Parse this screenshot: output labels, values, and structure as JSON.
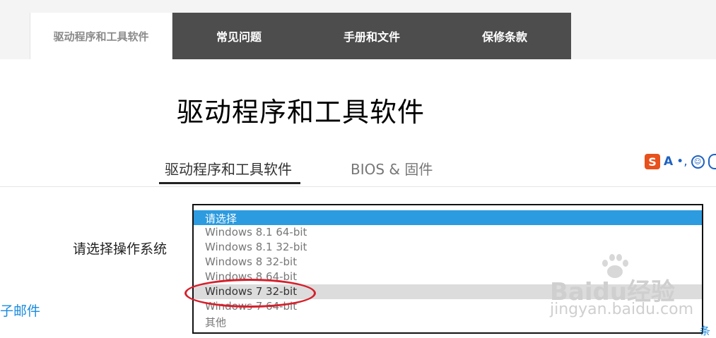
{
  "nav": {
    "tabs": [
      {
        "label": "驱动程序和工具软件",
        "active": true
      },
      {
        "label": "常见问题"
      },
      {
        "label": "手册和文件"
      },
      {
        "label": "保修条款"
      }
    ]
  },
  "main": {
    "title": "驱动程序和工具软件",
    "subtabs": [
      {
        "label": "驱动程序和工具软件",
        "active": true
      },
      {
        "label": "BIOS & 固件"
      }
    ],
    "os_label": "请选择操作系统",
    "email_link": "子邮件"
  },
  "os_select": {
    "options": [
      {
        "label": "请选择",
        "selected": true
      },
      {
        "label": "Windows 8.1 64-bit"
      },
      {
        "label": "Windows 8.1 32-bit"
      },
      {
        "label": "Windows 8 32-bit"
      },
      {
        "label": "Windows 8 64-bit"
      },
      {
        "label": "Windows 7 32-bit",
        "highlighted": true
      },
      {
        "label": "Windows 7 64-bit"
      },
      {
        "label": "其他"
      }
    ]
  },
  "ime_toolbar": {
    "logo_letter": "S",
    "mode_letter": "A",
    "punct": "•,",
    "emoji": "☺"
  },
  "watermark": {
    "brand": "Baidu经验",
    "url": "jingyan.baidu.com"
  },
  "corner_text": "条",
  "colors": {
    "nav_bg": "#4d4d4d",
    "select_highlight": "#2c9be0",
    "annotation_red": "#d61f2b",
    "link_blue": "#1a8be0"
  }
}
